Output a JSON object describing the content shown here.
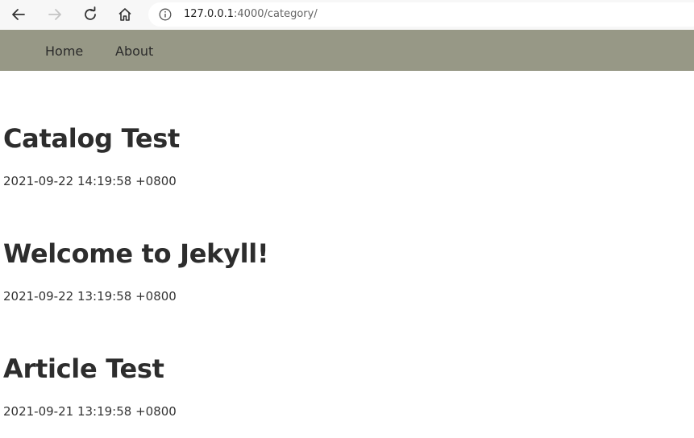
{
  "browser": {
    "back_icon": "arrow-left-icon",
    "forward_icon": "arrow-right-icon",
    "reload_icon": "reload-icon",
    "home_icon": "home-icon",
    "info_icon": "info-icon",
    "url_host": "127.0.0.1",
    "url_rest": ":4000/category/"
  },
  "nav": {
    "background": "#979886",
    "items": [
      {
        "label": "Home"
      },
      {
        "label": "About"
      }
    ]
  },
  "posts": [
    {
      "title": "Catalog Test",
      "date": "2021-09-22 14:19:58 +0800"
    },
    {
      "title": "Welcome to Jekyll!",
      "date": "2021-09-22 13:19:58 +0800"
    },
    {
      "title": "Article Test",
      "date": "2021-09-21 13:19:58 +0800"
    }
  ]
}
